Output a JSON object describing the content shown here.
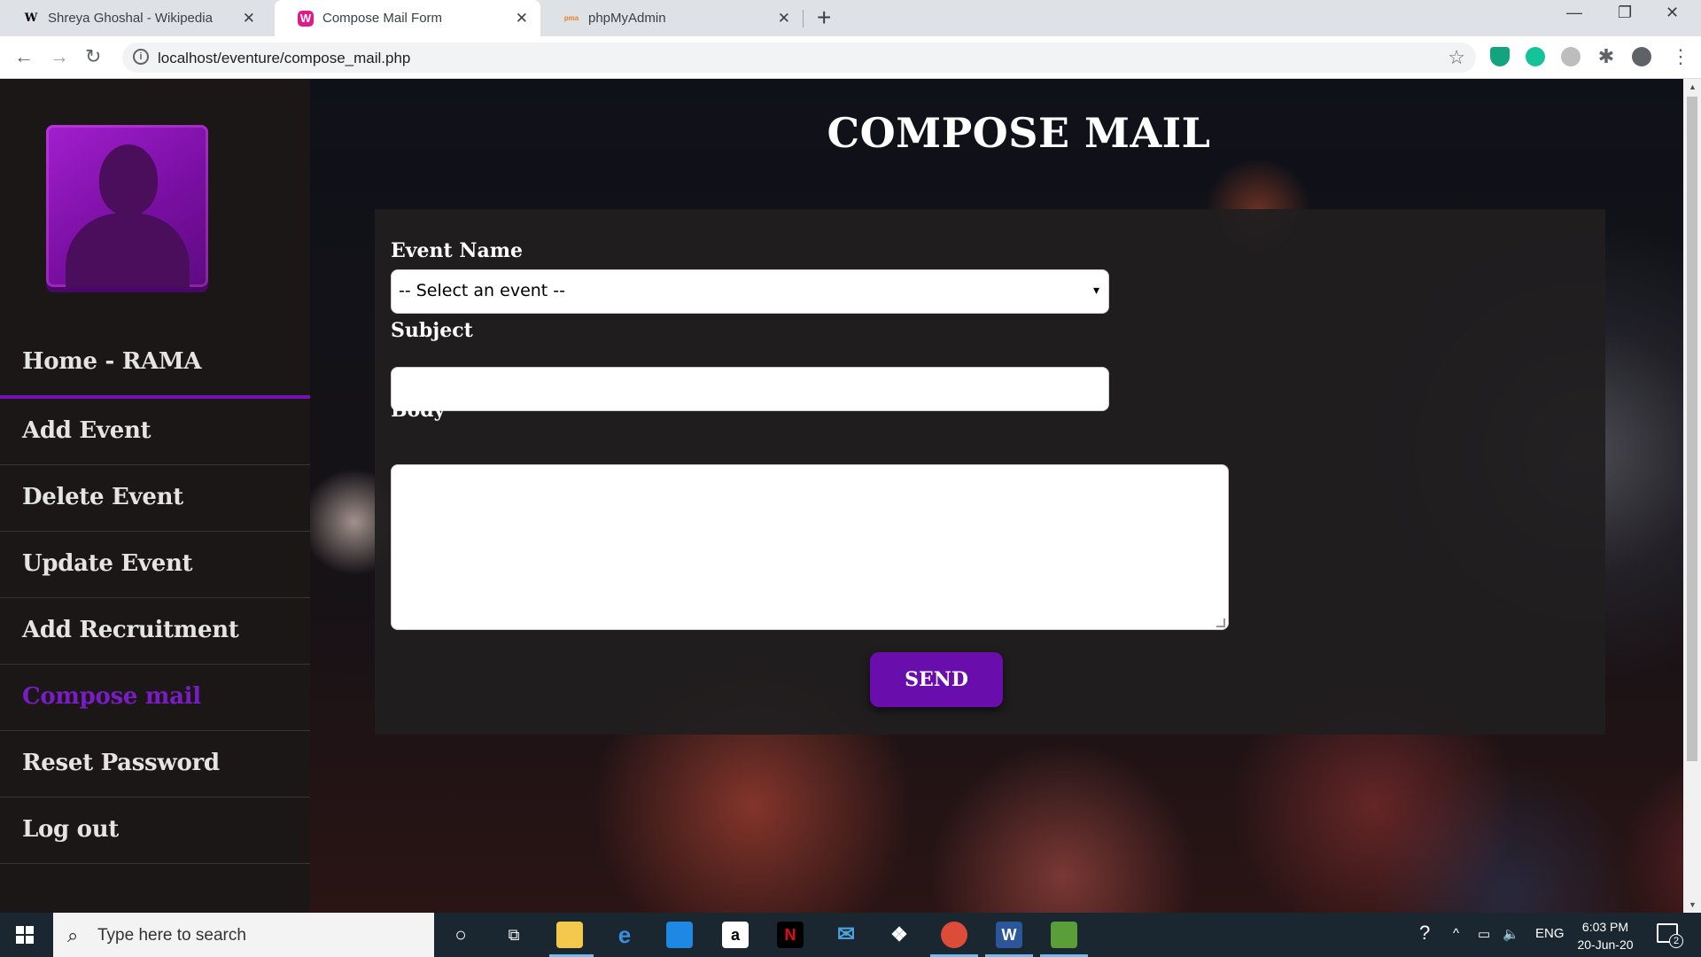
{
  "browser": {
    "tabs": [
      {
        "title": "Shreya Ghoshal - Wikipedia",
        "favicon": "W"
      },
      {
        "title": "Compose Mail Form",
        "favicon": "W"
      },
      {
        "title": "phpMyAdmin",
        "favicon": "pma"
      }
    ],
    "url": "localhost/eventure/compose_mail.php"
  },
  "sidebar": {
    "items": [
      {
        "label": "Home - RAMA"
      },
      {
        "label": "Add Event"
      },
      {
        "label": "Delete Event"
      },
      {
        "label": "Update Event"
      },
      {
        "label": "Add Recruitment"
      },
      {
        "label": "Compose mail"
      },
      {
        "label": "Reset Password"
      },
      {
        "label": "Log out"
      }
    ],
    "active": "Compose mail",
    "accent_color": "#6a0dad"
  },
  "main": {
    "title": "COMPOSE MAIL",
    "form": {
      "event_label": "Event Name",
      "event_selected": "-- Select an event --",
      "subject_label": "Subject",
      "subject_value": "",
      "body_label": "Body",
      "body_value": "",
      "send_label": "SEND"
    }
  },
  "taskbar": {
    "search_placeholder": "Type here to search",
    "language": "ENG",
    "time": "6:03 PM",
    "date": "20-Jun-20",
    "notification_count": "2"
  }
}
